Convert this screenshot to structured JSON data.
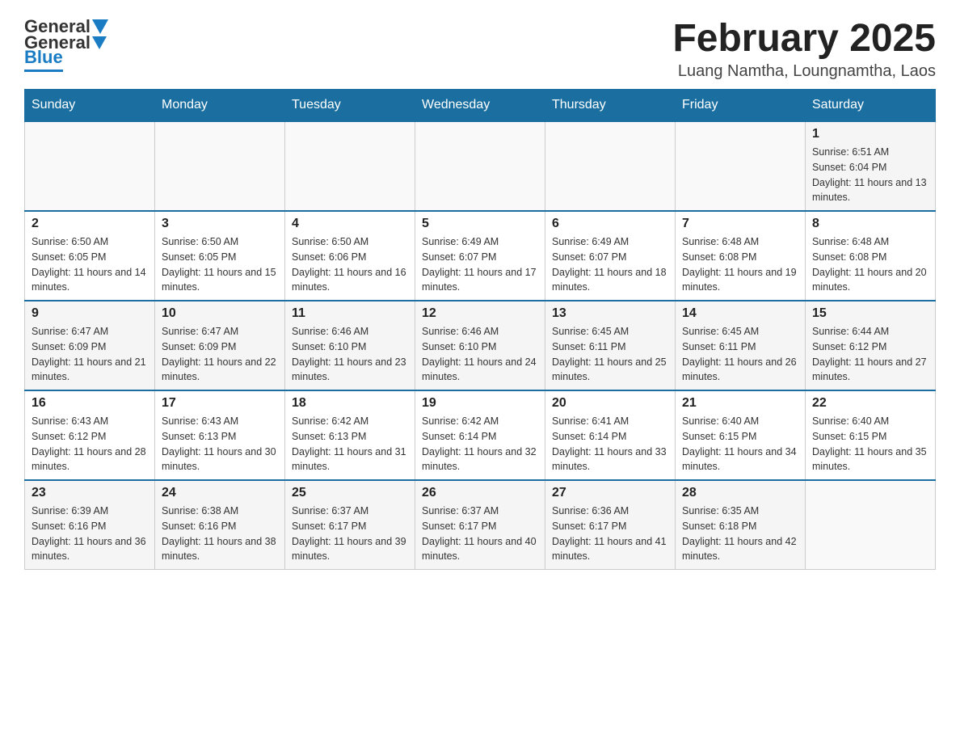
{
  "logo": {
    "general": "General",
    "blue": "Blue"
  },
  "header": {
    "title": "February 2025",
    "location": "Luang Namtha, Loungnamtha, Laos"
  },
  "weekdays": [
    "Sunday",
    "Monday",
    "Tuesday",
    "Wednesday",
    "Thursday",
    "Friday",
    "Saturday"
  ],
  "weeks": [
    [
      {
        "day": "",
        "info": ""
      },
      {
        "day": "",
        "info": ""
      },
      {
        "day": "",
        "info": ""
      },
      {
        "day": "",
        "info": ""
      },
      {
        "day": "",
        "info": ""
      },
      {
        "day": "",
        "info": ""
      },
      {
        "day": "1",
        "info": "Sunrise: 6:51 AM\nSunset: 6:04 PM\nDaylight: 11 hours and 13 minutes."
      }
    ],
    [
      {
        "day": "2",
        "info": "Sunrise: 6:50 AM\nSunset: 6:05 PM\nDaylight: 11 hours and 14 minutes."
      },
      {
        "day": "3",
        "info": "Sunrise: 6:50 AM\nSunset: 6:05 PM\nDaylight: 11 hours and 15 minutes."
      },
      {
        "day": "4",
        "info": "Sunrise: 6:50 AM\nSunset: 6:06 PM\nDaylight: 11 hours and 16 minutes."
      },
      {
        "day": "5",
        "info": "Sunrise: 6:49 AM\nSunset: 6:07 PM\nDaylight: 11 hours and 17 minutes."
      },
      {
        "day": "6",
        "info": "Sunrise: 6:49 AM\nSunset: 6:07 PM\nDaylight: 11 hours and 18 minutes."
      },
      {
        "day": "7",
        "info": "Sunrise: 6:48 AM\nSunset: 6:08 PM\nDaylight: 11 hours and 19 minutes."
      },
      {
        "day": "8",
        "info": "Sunrise: 6:48 AM\nSunset: 6:08 PM\nDaylight: 11 hours and 20 minutes."
      }
    ],
    [
      {
        "day": "9",
        "info": "Sunrise: 6:47 AM\nSunset: 6:09 PM\nDaylight: 11 hours and 21 minutes."
      },
      {
        "day": "10",
        "info": "Sunrise: 6:47 AM\nSunset: 6:09 PM\nDaylight: 11 hours and 22 minutes."
      },
      {
        "day": "11",
        "info": "Sunrise: 6:46 AM\nSunset: 6:10 PM\nDaylight: 11 hours and 23 minutes."
      },
      {
        "day": "12",
        "info": "Sunrise: 6:46 AM\nSunset: 6:10 PM\nDaylight: 11 hours and 24 minutes."
      },
      {
        "day": "13",
        "info": "Sunrise: 6:45 AM\nSunset: 6:11 PM\nDaylight: 11 hours and 25 minutes."
      },
      {
        "day": "14",
        "info": "Sunrise: 6:45 AM\nSunset: 6:11 PM\nDaylight: 11 hours and 26 minutes."
      },
      {
        "day": "15",
        "info": "Sunrise: 6:44 AM\nSunset: 6:12 PM\nDaylight: 11 hours and 27 minutes."
      }
    ],
    [
      {
        "day": "16",
        "info": "Sunrise: 6:43 AM\nSunset: 6:12 PM\nDaylight: 11 hours and 28 minutes."
      },
      {
        "day": "17",
        "info": "Sunrise: 6:43 AM\nSunset: 6:13 PM\nDaylight: 11 hours and 30 minutes."
      },
      {
        "day": "18",
        "info": "Sunrise: 6:42 AM\nSunset: 6:13 PM\nDaylight: 11 hours and 31 minutes."
      },
      {
        "day": "19",
        "info": "Sunrise: 6:42 AM\nSunset: 6:14 PM\nDaylight: 11 hours and 32 minutes."
      },
      {
        "day": "20",
        "info": "Sunrise: 6:41 AM\nSunset: 6:14 PM\nDaylight: 11 hours and 33 minutes."
      },
      {
        "day": "21",
        "info": "Sunrise: 6:40 AM\nSunset: 6:15 PM\nDaylight: 11 hours and 34 minutes."
      },
      {
        "day": "22",
        "info": "Sunrise: 6:40 AM\nSunset: 6:15 PM\nDaylight: 11 hours and 35 minutes."
      }
    ],
    [
      {
        "day": "23",
        "info": "Sunrise: 6:39 AM\nSunset: 6:16 PM\nDaylight: 11 hours and 36 minutes."
      },
      {
        "day": "24",
        "info": "Sunrise: 6:38 AM\nSunset: 6:16 PM\nDaylight: 11 hours and 38 minutes."
      },
      {
        "day": "25",
        "info": "Sunrise: 6:37 AM\nSunset: 6:17 PM\nDaylight: 11 hours and 39 minutes."
      },
      {
        "day": "26",
        "info": "Sunrise: 6:37 AM\nSunset: 6:17 PM\nDaylight: 11 hours and 40 minutes."
      },
      {
        "day": "27",
        "info": "Sunrise: 6:36 AM\nSunset: 6:17 PM\nDaylight: 11 hours and 41 minutes."
      },
      {
        "day": "28",
        "info": "Sunrise: 6:35 AM\nSunset: 6:18 PM\nDaylight: 11 hours and 42 minutes."
      },
      {
        "day": "",
        "info": ""
      }
    ]
  ]
}
